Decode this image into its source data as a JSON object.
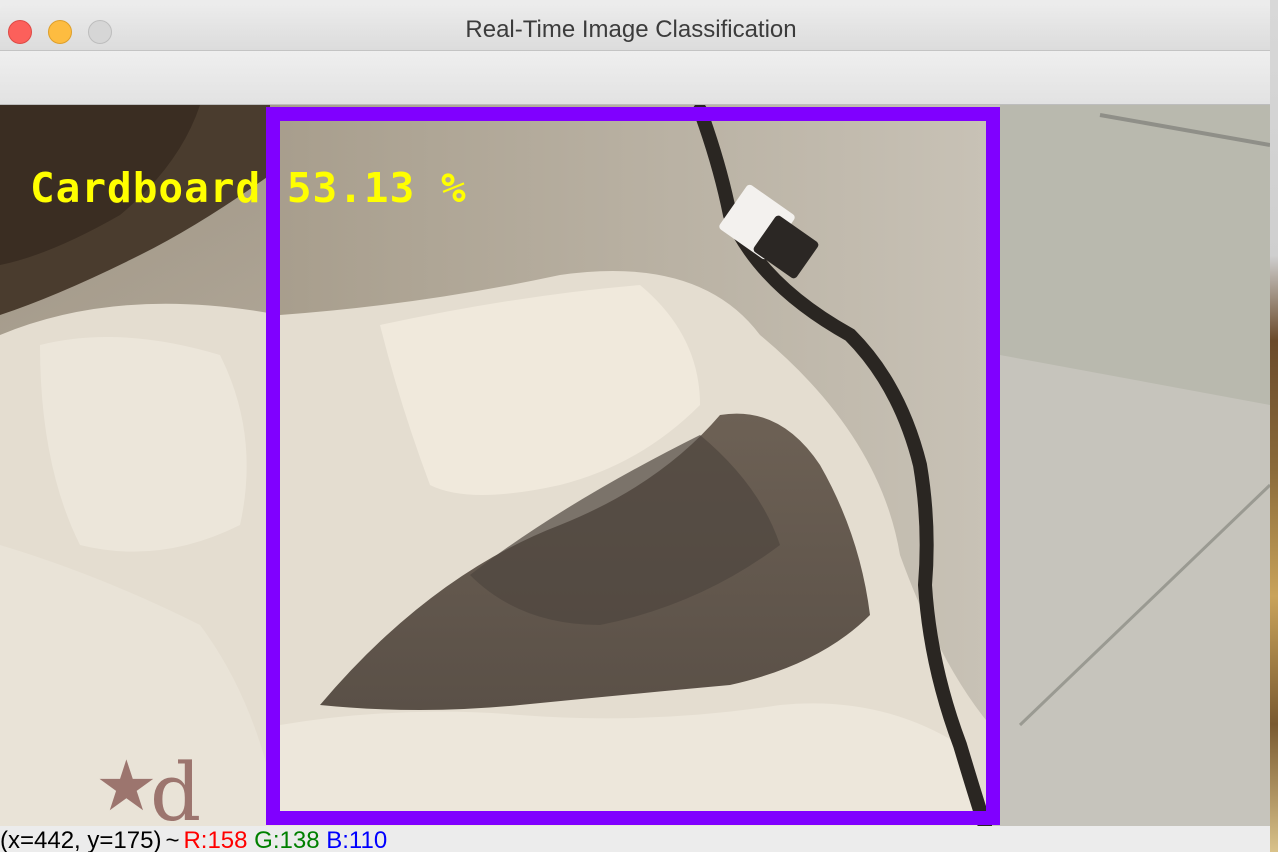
{
  "window": {
    "title": "Real-Time Image Classification"
  },
  "prediction": {
    "label": "Cardboard",
    "confidence": "53.13 %",
    "box_color": "#8000ff",
    "text_color": "#ffff00"
  },
  "status": {
    "coords": "(x=442, y=175)",
    "separator": "~",
    "r": "R:158",
    "g": "G:138",
    "b": "B:110",
    "r_color": "#ff0000",
    "g_color": "#008000",
    "b_color": "#0000ff"
  },
  "icons": {
    "close": "close-button",
    "minimize": "minimize-button",
    "zoom": "zoom-button"
  }
}
